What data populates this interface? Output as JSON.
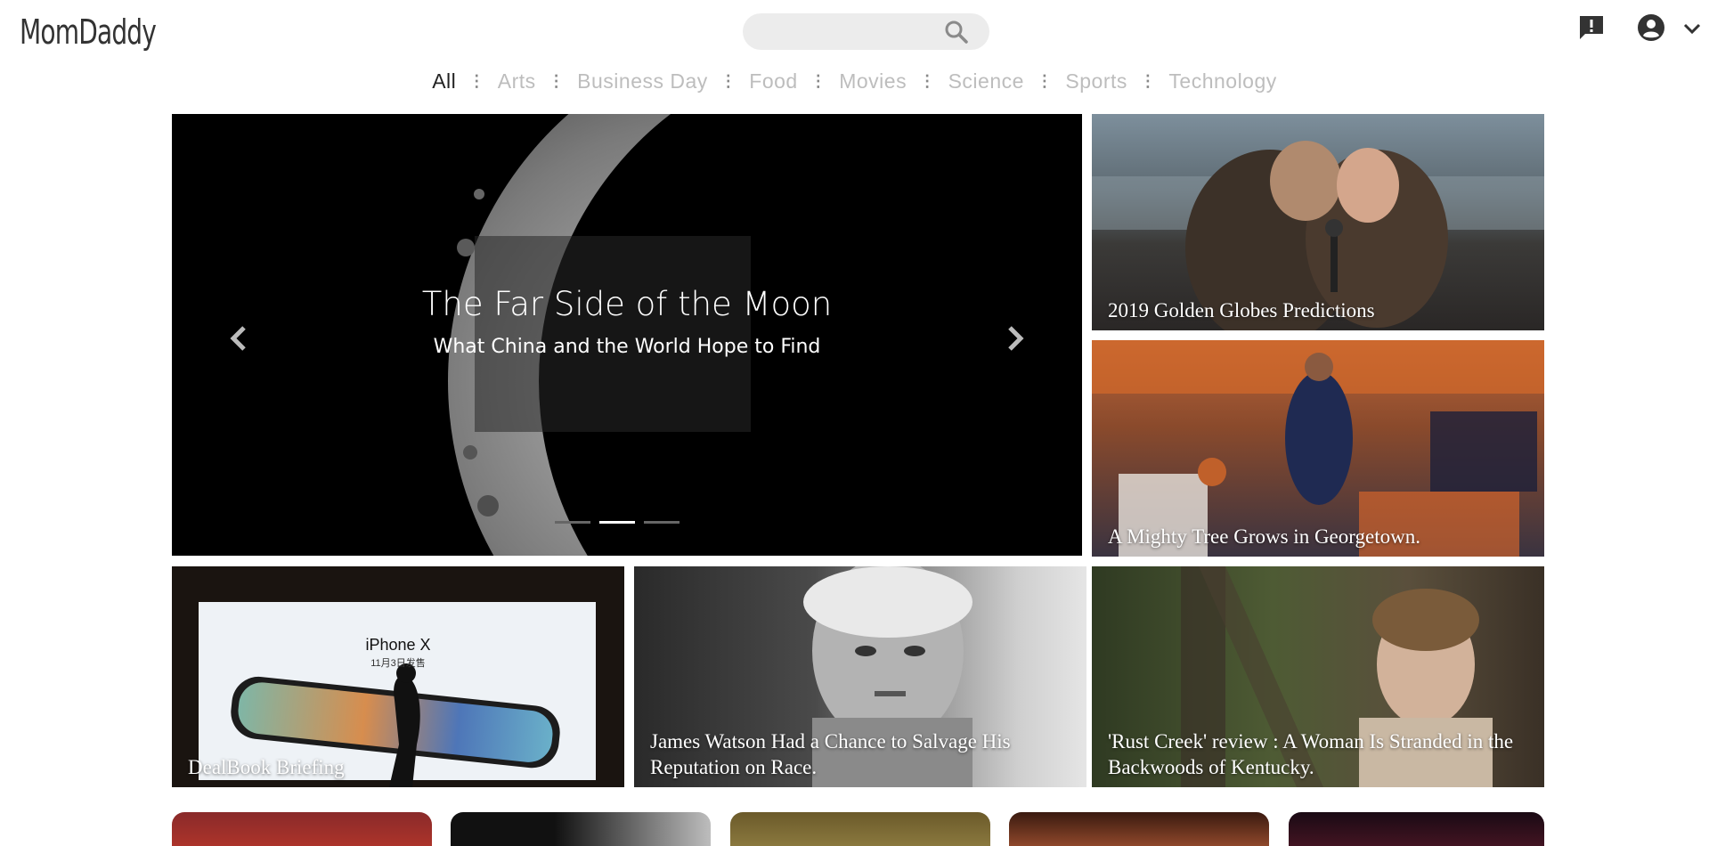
{
  "header": {
    "logo": "MomDaddy",
    "search_placeholder": "",
    "icons": [
      "search-icon",
      "feedback-icon",
      "account-icon",
      "chevron-down-icon"
    ]
  },
  "nav": {
    "items": [
      "All",
      "Arts",
      "Business Day",
      "Food",
      "Movies",
      "Science",
      "Sports",
      "Technology"
    ],
    "active": "All"
  },
  "hero": {
    "title": "The Far Side of the Moon",
    "subtitle": "What China and the World Hope to Find",
    "slide_count": 3,
    "active_slide": 2
  },
  "tiles": [
    {
      "caption": "2019 Golden Globes Predictions"
    },
    {
      "caption": "A Mighty Tree Grows in Georgetown."
    },
    {
      "caption": "DealBook Briefing"
    },
    {
      "caption": "James Watson Had a Chance to Salvage His Reputation on Race."
    },
    {
      "caption": "'Rust Creek' review : A Woman Is Stranded in the Backwoods of Kentucky."
    }
  ],
  "iphone_ad": {
    "brand": "iPhone X",
    "date": "11月3日发售"
  }
}
